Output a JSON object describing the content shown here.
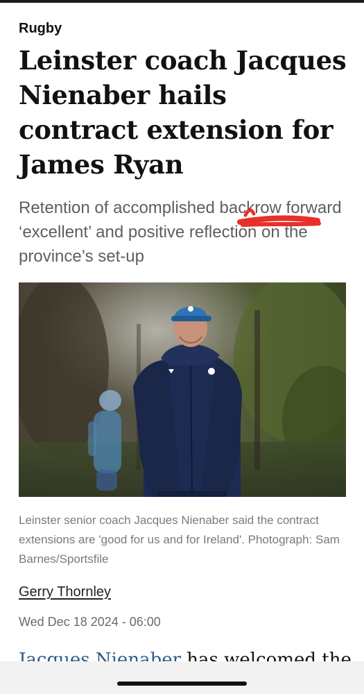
{
  "article": {
    "section": "Rugby",
    "headline": "Leinster coach Jacques Nienaber hails contract extension for James Ryan",
    "standfirst": "Retention of accomplished backrow forward ‘excellent’ and positive reflection on the province’s set-up",
    "photo_caption": "Leinster senior coach Jacques Nienaber said the contract extensions are 'good for us and for Ireland'. Photograph: Sam Barnes/Sportsfile",
    "author": "Gerry Thornley",
    "date": "Wed Dec 18 2024 - 06:00",
    "body_link": "Jacques Nienaber",
    "body_rest": " has welcomed the"
  },
  "colors": {
    "link": "#2f5b8a",
    "standfirst": "#5e5e5e",
    "annotation": "#e8302a"
  }
}
